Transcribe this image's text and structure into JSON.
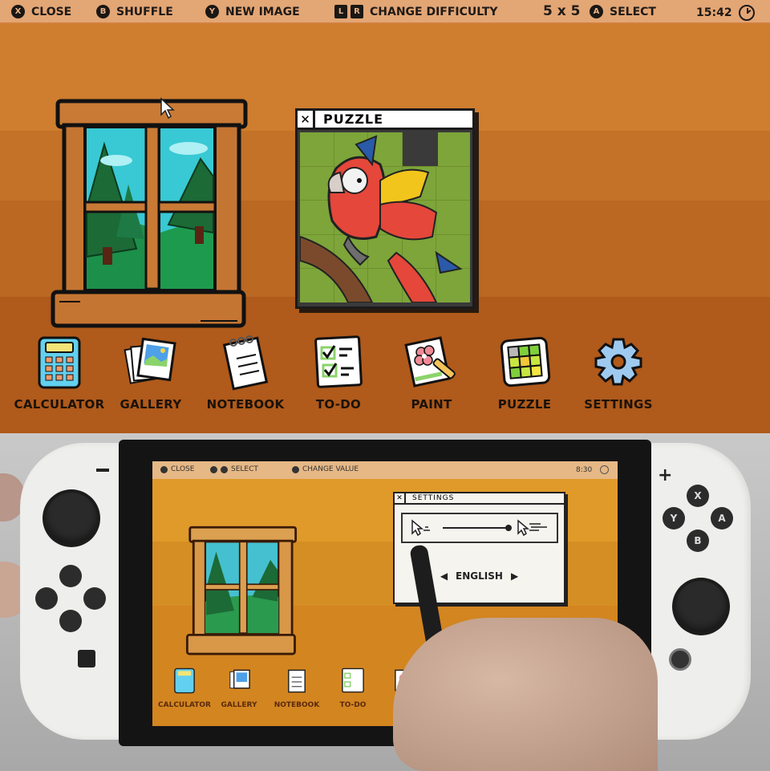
{
  "top_screen": {
    "topbar": {
      "hints": [
        {
          "button": "X",
          "label": "CLOSE"
        },
        {
          "button": "B",
          "label": "SHUFFLE"
        },
        {
          "button": "Y",
          "label": "NEW IMAGE"
        },
        {
          "buttons": [
            "L",
            "R"
          ],
          "label": "CHANGE DIFFICULTY"
        },
        {
          "button": "A",
          "label": "SELECT"
        }
      ],
      "difficulty": "5 x 5",
      "time": "15:42",
      "clock_icon": "clock-icon"
    },
    "puzzle_window": {
      "close_label": "✕",
      "title": "PUZZLE",
      "grid_size": 5,
      "empty_tile": {
        "row": 0,
        "col": 3
      }
    },
    "apps": [
      {
        "label": "CALCULATOR",
        "icon": "calculator-icon"
      },
      {
        "label": "GALLERY",
        "icon": "gallery-icon"
      },
      {
        "label": "NOTEBOOK",
        "icon": "notebook-icon"
      },
      {
        "label": "TO-DO",
        "icon": "todo-icon"
      },
      {
        "label": "PAINT",
        "icon": "paint-icon"
      },
      {
        "label": "PUZZLE",
        "icon": "puzzle-icon"
      },
      {
        "label": "SETTINGS",
        "icon": "gear-icon"
      }
    ]
  },
  "bottom_screen": {
    "topbar": {
      "hints": [
        {
          "label": "CLOSE"
        },
        {
          "label": "SELECT"
        },
        {
          "label": "CHANGE VALUE"
        }
      ],
      "time": "8:30"
    },
    "settings_window": {
      "close_label": "✕",
      "title": "SETTINGS",
      "cursor_speed": 1.0,
      "language": "ENGLISH",
      "lang_prev": "◀",
      "lang_next": "▶"
    },
    "apps": [
      {
        "label": "CALCULATOR"
      },
      {
        "label": "GALLERY"
      },
      {
        "label": "NOTEBOOK"
      },
      {
        "label": "TO-DO"
      }
    ],
    "controller": {
      "right_buttons": [
        "X",
        "Y",
        "A",
        "B"
      ],
      "plus": "+",
      "minus": "−"
    }
  }
}
